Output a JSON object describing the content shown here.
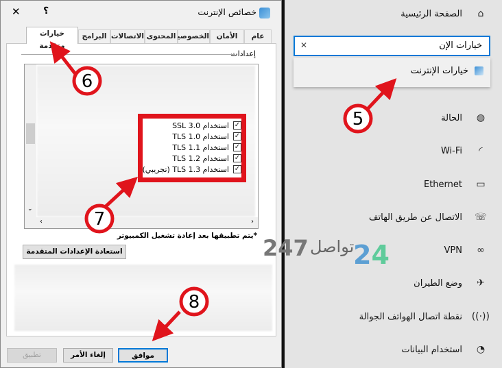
{
  "dialog": {
    "title": "خصائص الإنترنت",
    "help": "؟",
    "close": "✕",
    "tabs": [
      "عام",
      "الأمان",
      "الخصوصية",
      "المحتوى",
      "الاتصالات",
      "البرامج",
      "خيارات متقدمة"
    ],
    "section_label": "إعدادات",
    "items": [
      {
        "label": "استخدام SSL 3.0",
        "checked": true
      },
      {
        "label": "استخدام TLS 1.0",
        "checked": true
      },
      {
        "label": "استخدام TLS 1.1",
        "checked": true
      },
      {
        "label": "استخدام TLS 1.2",
        "checked": true
      },
      {
        "label": "استخدام TLS 1.3 (تجريبي)",
        "checked": true
      }
    ],
    "footnote": "*يتم تطبيقها بعد إعادة تشغيل الكمبيوتر",
    "restore_button": "استعادة الإعدادات المتقدمة",
    "ok_button": "موافق",
    "cancel_button": "إلغاء الأمر",
    "apply_button": "تطبيق"
  },
  "settings": {
    "home": "الصفحة الرئيسية",
    "search_value": "خيارات الإن",
    "clear": "✕",
    "suggestion": "خيارات الإنترنت",
    "nav": [
      {
        "label": "الحالة",
        "icon": "globe-icon"
      },
      {
        "label": "Wi-Fi",
        "icon": "wifi-icon"
      },
      {
        "label": "Ethernet",
        "icon": "ethernet-icon"
      },
      {
        "label": "الاتصال عن طريق الهاتف",
        "icon": "dialup-icon"
      },
      {
        "label": "VPN",
        "icon": "vpn-icon"
      },
      {
        "label": "وضع الطيران",
        "icon": "airplane-icon"
      },
      {
        "label": "نقطة اتصال الهواتف الجوالة",
        "icon": "hotspot-icon"
      },
      {
        "label": "استخدام البيانات",
        "icon": "data-usage-icon"
      }
    ]
  },
  "annotations": [
    "5",
    "6",
    "7",
    "8"
  ],
  "watermark": {
    "number": "247",
    "word": "تواصل"
  },
  "colors": {
    "annotation_red": "#e0141c",
    "focus_blue": "#0078d7"
  }
}
